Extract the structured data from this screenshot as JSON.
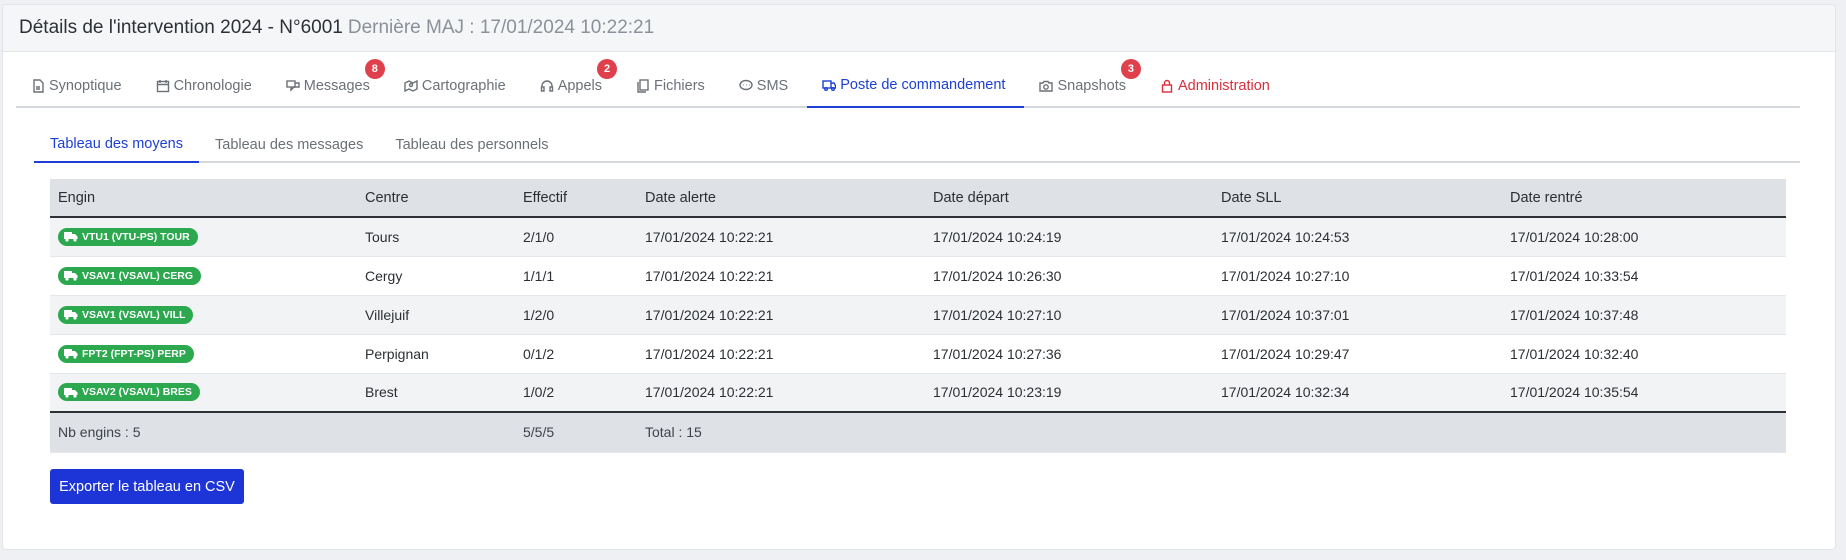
{
  "header": {
    "title": "Détails de l'intervention 2024 - N°6001",
    "subtitle": "Dernière MAJ : 17/01/2024 10:22:21"
  },
  "tabs": [
    {
      "label": "Synoptique",
      "icon": "document-icon",
      "badge": ""
    },
    {
      "label": "Chronologie",
      "icon": "calendar-icon",
      "badge": ""
    },
    {
      "label": "Messages",
      "icon": "messages-icon",
      "badge": "8"
    },
    {
      "label": "Cartographie",
      "icon": "map-icon",
      "badge": ""
    },
    {
      "label": "Appels",
      "icon": "headset-icon",
      "badge": "2"
    },
    {
      "label": "Fichiers",
      "icon": "files-icon",
      "badge": ""
    },
    {
      "label": "SMS",
      "icon": "sms-icon",
      "badge": ""
    },
    {
      "label": "Poste de commandement",
      "icon": "truck-icon",
      "badge": ""
    },
    {
      "label": "Snapshots",
      "icon": "camera-icon",
      "badge": "3"
    },
    {
      "label": "Administration",
      "icon": "lock-icon",
      "badge": ""
    }
  ],
  "active_tab": "Poste de commandement",
  "sub_tabs": [
    "Tableau des moyens",
    "Tableau des messages",
    "Tableau des personnels"
  ],
  "active_sub_tab": "Tableau des moyens",
  "table": {
    "columns": [
      "Engin",
      "Centre",
      "Effectif",
      "Date alerte",
      "Date départ",
      "Date SLL",
      "Date rentré"
    ],
    "rows": [
      {
        "engin": "VTU1 (VTU-PS) TOUR",
        "centre": "Tours",
        "effectif": "2/1/0",
        "alerte": "17/01/2024 10:22:21",
        "depart": "17/01/2024 10:24:19",
        "sll": "17/01/2024 10:24:53",
        "rentre": "17/01/2024 10:28:00"
      },
      {
        "engin": "VSAV1 (VSAVL) CERG",
        "centre": "Cergy",
        "effectif": "1/1/1",
        "alerte": "17/01/2024 10:22:21",
        "depart": "17/01/2024 10:26:30",
        "sll": "17/01/2024 10:27:10",
        "rentre": "17/01/2024 10:33:54"
      },
      {
        "engin": "VSAV1 (VSAVL) VILL",
        "centre": "Villejuif",
        "effectif": "1/2/0",
        "alerte": "17/01/2024 10:22:21",
        "depart": "17/01/2024 10:27:10",
        "sll": "17/01/2024 10:37:01",
        "rentre": "17/01/2024 10:37:48"
      },
      {
        "engin": "FPT2 (FPT-PS) PERP",
        "centre": "Perpignan",
        "effectif": "0/1/2",
        "alerte": "17/01/2024 10:22:21",
        "depart": "17/01/2024 10:27:36",
        "sll": "17/01/2024 10:29:47",
        "rentre": "17/01/2024 10:32:40"
      },
      {
        "engin": "VSAV2 (VSAVL) BRES",
        "centre": "Brest",
        "effectif": "1/0/2",
        "alerte": "17/01/2024 10:22:21",
        "depart": "17/01/2024 10:23:19",
        "sll": "17/01/2024 10:32:34",
        "rentre": "17/01/2024 10:35:54"
      }
    ],
    "footer": {
      "count": "Nb engins : 5",
      "effectif": "5/5/5",
      "total": "Total : 15"
    }
  },
  "export_button": "Exporter le tableau en CSV",
  "colors": {
    "accent": "#1d3fd6",
    "badge": "#e0404b",
    "engin_pill": "#2ca84f",
    "danger": "#d9303b"
  }
}
